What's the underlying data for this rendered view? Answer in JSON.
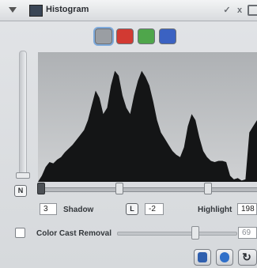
{
  "window": {
    "title": "Histogram",
    "buttons": {
      "check": "✓",
      "close": "x",
      "collapse_icon": "panel-toggle-icon"
    }
  },
  "channels": [
    {
      "name": "luminance",
      "color": "#9a9ea3",
      "selected": true
    },
    {
      "name": "red",
      "color": "#d23a32",
      "selected": false
    },
    {
      "name": "green",
      "color": "#4fa64b",
      "selected": false
    },
    {
      "name": "blue",
      "color": "#3b62c2",
      "selected": false
    }
  ],
  "histogram": {
    "mode_label": "N",
    "levels": [
      0,
      0.05,
      0.12,
      0.16,
      0.15,
      0.18,
      0.2,
      0.24,
      0.27,
      0.3,
      0.34,
      0.38,
      0.42,
      0.5,
      0.62,
      0.74,
      0.68,
      0.55,
      0.6,
      0.78,
      0.9,
      0.86,
      0.7,
      0.6,
      0.55,
      0.7,
      0.82,
      0.9,
      0.85,
      0.78,
      0.65,
      0.5,
      0.4,
      0.35,
      0.3,
      0.25,
      0.22,
      0.2,
      0.28,
      0.45,
      0.55,
      0.5,
      0.36,
      0.25,
      0.2,
      0.17,
      0.16,
      0.17,
      0.17,
      0.16,
      0.05,
      0.02,
      0.03,
      0.01,
      0.02,
      0.4,
      0.45,
      0.5
    ]
  },
  "levels": {
    "shadow_label": "Shadow",
    "shadow_value": "3",
    "midtone_label": "L",
    "midtone_value": "-2",
    "highlight_label": "Highlight",
    "highlight_value": "198",
    "shadow_pos": 0.0,
    "midtone_pos": 0.36,
    "highlight_pos": 0.76
  },
  "color_cast": {
    "label": "Color Cast Removal",
    "value": "69",
    "enabled": false,
    "position": 0.65
  },
  "toolbar": [
    "auto-levels-icon",
    "reset-icon",
    "refresh-icon"
  ]
}
